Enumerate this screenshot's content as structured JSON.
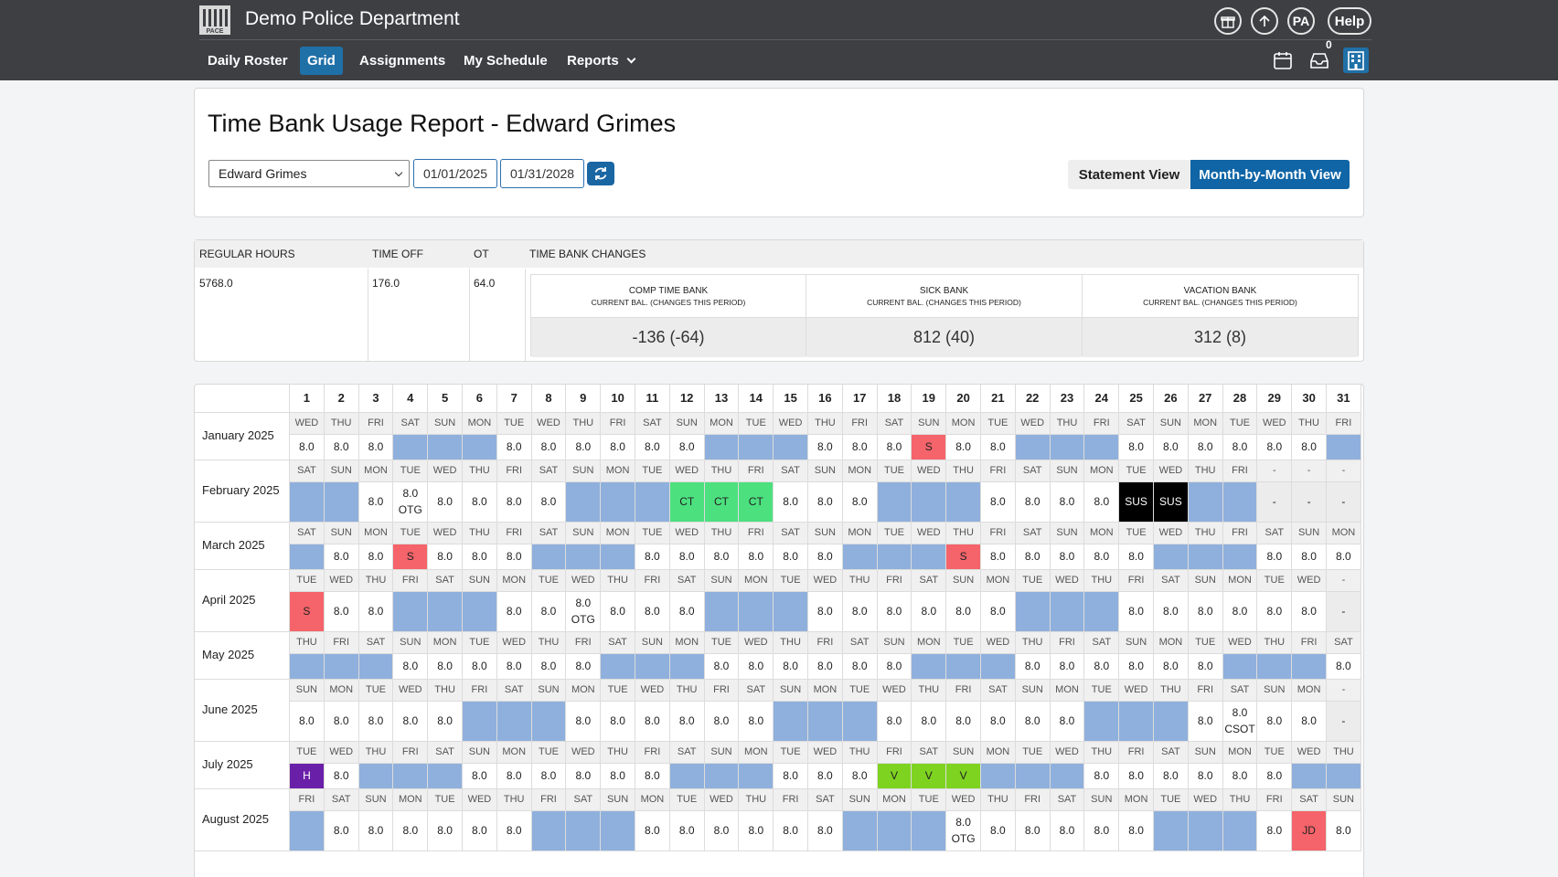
{
  "app": {
    "title": "Demo Police Department",
    "logo_text": "PACE"
  },
  "header_buttons": {
    "gift": "gift-icon",
    "upload": "upload-icon",
    "profile": "PA",
    "help": "Help"
  },
  "nav": [
    {
      "label": "Daily Roster",
      "active": false
    },
    {
      "label": "Grid",
      "active": true
    },
    {
      "label": "Assignments",
      "active": false
    },
    {
      "label": "My Schedule",
      "active": false
    },
    {
      "label": "Reports",
      "active": false,
      "dropdown": true
    }
  ],
  "header_icons": {
    "calendar": "calendar-icon",
    "inbox": "inbox-icon",
    "inbox_count": "0",
    "building": "building-icon"
  },
  "report": {
    "title": "Time Bank Usage Report - Edward Grimes",
    "employee": "Edward Grimes",
    "start_date": "01/01/2025",
    "end_date": "01/31/2028",
    "statement_view": "Statement View",
    "month_view": "Month-by-Month View"
  },
  "summary": {
    "headers": [
      "REGULAR HOURS",
      "TIME OFF",
      "OT",
      "TIME BANK CHANGES"
    ],
    "regular_hours": "5768.0",
    "time_off": "176.0",
    "ot": "64.0",
    "banks": [
      {
        "name": "COMP TIME BANK",
        "sub": "CURRENT BAL. (CHANGES THIS PERIOD)",
        "value": "-136 (-64)"
      },
      {
        "name": "SICK BANK",
        "sub": "CURRENT BAL. (CHANGES THIS PERIOD)",
        "value": "812 (40)"
      },
      {
        "name": "VACATION BANK",
        "sub": "CURRENT BAL. (CHANGES THIS PERIOD)",
        "value": "312 (8)"
      }
    ]
  },
  "colors": {
    "off": "#8fb0dc",
    "sick": "#f4646a",
    "comp": "#4ce07f",
    "vacation": "#7ed321",
    "holiday": "#6a1fa8",
    "suspension": "#000000",
    "blank": "#ececec",
    "accent": "#0f65a6",
    "topbar": "#3d3f43"
  },
  "grid": {
    "days": [
      "1",
      "2",
      "3",
      "4",
      "5",
      "6",
      "7",
      "8",
      "9",
      "10",
      "11",
      "12",
      "13",
      "14",
      "15",
      "16",
      "17",
      "18",
      "19",
      "20",
      "21",
      "22",
      "23",
      "24",
      "25",
      "26",
      "27",
      "28",
      "29",
      "30",
      "31"
    ],
    "months": [
      {
        "label": "January 2025",
        "tall": false,
        "dows": [
          "WED",
          "THU",
          "FRI",
          "SAT",
          "SUN",
          "MON",
          "TUE",
          "WED",
          "THU",
          "FRI",
          "SAT",
          "SUN",
          "MON",
          "TUE",
          "WED",
          "THU",
          "FRI",
          "SAT",
          "SUN",
          "MON",
          "TUE",
          "WED",
          "THU",
          "FRI",
          "SAT",
          "SUN",
          "MON",
          "TUE",
          "WED",
          "THU",
          "FRI"
        ],
        "cells": [
          "8.0",
          "8.0",
          "8.0",
          "off",
          "off",
          "off",
          "8.0",
          "8.0",
          "8.0",
          "8.0",
          "8.0",
          "8.0",
          "off",
          "off",
          "off",
          "8.0",
          "8.0",
          "8.0",
          "S",
          "8.0",
          "8.0",
          "off",
          "off",
          "off",
          "8.0",
          "8.0",
          "8.0",
          "8.0",
          "8.0",
          "8.0",
          "off"
        ]
      },
      {
        "label": "February 2025",
        "tall": true,
        "dows": [
          "SAT",
          "SUN",
          "MON",
          "TUE",
          "WED",
          "THU",
          "FRI",
          "SAT",
          "SUN",
          "MON",
          "TUE",
          "WED",
          "THU",
          "FRI",
          "SAT",
          "SUN",
          "MON",
          "TUE",
          "WED",
          "THU",
          "FRI",
          "SAT",
          "SUN",
          "MON",
          "TUE",
          "WED",
          "THU",
          "FRI",
          "-",
          "-",
          "-"
        ],
        "cells": [
          "off",
          "off",
          "8.0",
          "8.0\nOTG",
          "8.0",
          "8.0",
          "8.0",
          "8.0",
          "off",
          "off",
          "off",
          "CT",
          "CT",
          "CT",
          "8.0",
          "8.0",
          "8.0",
          "off",
          "off",
          "off",
          "8.0",
          "8.0",
          "8.0",
          "8.0",
          "SUS",
          "SUS",
          "off",
          "off",
          "-",
          "-",
          "-"
        ]
      },
      {
        "label": "March 2025",
        "tall": false,
        "dows": [
          "SAT",
          "SUN",
          "MON",
          "TUE",
          "WED",
          "THU",
          "FRI",
          "SAT",
          "SUN",
          "MON",
          "TUE",
          "WED",
          "THU",
          "FRI",
          "SAT",
          "SUN",
          "MON",
          "TUE",
          "WED",
          "THU",
          "FRI",
          "SAT",
          "SUN",
          "MON",
          "TUE",
          "WED",
          "THU",
          "FRI",
          "SAT",
          "SUN",
          "MON"
        ],
        "cells": [
          "off",
          "8.0",
          "8.0",
          "S",
          "8.0",
          "8.0",
          "8.0",
          "off",
          "off",
          "off",
          "8.0",
          "8.0",
          "8.0",
          "8.0",
          "8.0",
          "8.0",
          "off",
          "off",
          "off",
          "S",
          "8.0",
          "8.0",
          "8.0",
          "8.0",
          "8.0",
          "off",
          "off",
          "off",
          "8.0",
          "8.0",
          "8.0"
        ]
      },
      {
        "label": "April 2025",
        "tall": true,
        "dows": [
          "TUE",
          "WED",
          "THU",
          "FRI",
          "SAT",
          "SUN",
          "MON",
          "TUE",
          "WED",
          "THU",
          "FRI",
          "SAT",
          "SUN",
          "MON",
          "TUE",
          "WED",
          "THU",
          "FRI",
          "SAT",
          "SUN",
          "MON",
          "TUE",
          "WED",
          "THU",
          "FRI",
          "SAT",
          "SUN",
          "MON",
          "TUE",
          "WED",
          "-"
        ],
        "cells": [
          "S",
          "8.0",
          "8.0",
          "off",
          "off",
          "off",
          "8.0",
          "8.0",
          "8.0\nOTG",
          "8.0",
          "8.0",
          "8.0",
          "off",
          "off",
          "off",
          "8.0",
          "8.0",
          "8.0",
          "8.0",
          "8.0",
          "8.0",
          "off",
          "off",
          "off",
          "8.0",
          "8.0",
          "8.0",
          "8.0",
          "8.0",
          "8.0",
          "-"
        ]
      },
      {
        "label": "May 2025",
        "tall": false,
        "dows": [
          "THU",
          "FRI",
          "SAT",
          "SUN",
          "MON",
          "TUE",
          "WED",
          "THU",
          "FRI",
          "SAT",
          "SUN",
          "MON",
          "TUE",
          "WED",
          "THU",
          "FRI",
          "SAT",
          "SUN",
          "MON",
          "TUE",
          "WED",
          "THU",
          "FRI",
          "SAT",
          "SUN",
          "MON",
          "TUE",
          "WED",
          "THU",
          "FRI",
          "SAT"
        ],
        "cells": [
          "off",
          "off",
          "off",
          "8.0",
          "8.0",
          "8.0",
          "8.0",
          "8.0",
          "8.0",
          "off",
          "off",
          "off",
          "8.0",
          "8.0",
          "8.0",
          "8.0",
          "8.0",
          "8.0",
          "off",
          "off",
          "off",
          "8.0",
          "8.0",
          "8.0",
          "8.0",
          "8.0",
          "8.0",
          "off",
          "off",
          "off",
          "8.0"
        ]
      },
      {
        "label": "June 2025",
        "tall": true,
        "dows": [
          "SUN",
          "MON",
          "TUE",
          "WED",
          "THU",
          "FRI",
          "SAT",
          "SUN",
          "MON",
          "TUE",
          "WED",
          "THU",
          "FRI",
          "SAT",
          "SUN",
          "MON",
          "TUE",
          "WED",
          "THU",
          "FRI",
          "SAT",
          "SUN",
          "MON",
          "TUE",
          "WED",
          "THU",
          "FRI",
          "SAT",
          "SUN",
          "MON",
          "-"
        ],
        "cells": [
          "8.0",
          "8.0",
          "8.0",
          "8.0",
          "8.0",
          "off",
          "off",
          "off",
          "8.0",
          "8.0",
          "8.0",
          "8.0",
          "8.0",
          "8.0",
          "off",
          "off",
          "off",
          "8.0",
          "8.0",
          "8.0",
          "8.0",
          "8.0",
          "8.0",
          "off",
          "off",
          "off",
          "8.0",
          "8.0\nCSOT",
          "8.0",
          "8.0",
          "-"
        ]
      },
      {
        "label": "July 2025",
        "tall": false,
        "dows": [
          "TUE",
          "WED",
          "THU",
          "FRI",
          "SAT",
          "SUN",
          "MON",
          "TUE",
          "WED",
          "THU",
          "FRI",
          "SAT",
          "SUN",
          "MON",
          "TUE",
          "WED",
          "THU",
          "FRI",
          "SAT",
          "SUN",
          "MON",
          "TUE",
          "WED",
          "THU",
          "FRI",
          "SAT",
          "SUN",
          "MON",
          "TUE",
          "WED",
          "THU"
        ],
        "cells": [
          "H",
          "8.0",
          "off",
          "off",
          "off",
          "8.0",
          "8.0",
          "8.0",
          "8.0",
          "8.0",
          "8.0",
          "off",
          "off",
          "off",
          "8.0",
          "8.0",
          "8.0",
          "V",
          "V",
          "V",
          "off",
          "off",
          "off",
          "8.0",
          "8.0",
          "8.0",
          "8.0",
          "8.0",
          "8.0",
          "off",
          "off"
        ]
      },
      {
        "label": "August 2025",
        "tall": true,
        "dows": [
          "FRI",
          "SAT",
          "SUN",
          "MON",
          "TUE",
          "WED",
          "THU",
          "FRI",
          "SAT",
          "SUN",
          "MON",
          "TUE",
          "WED",
          "THU",
          "FRI",
          "SAT",
          "SUN",
          "MON",
          "TUE",
          "WED",
          "THU",
          "FRI",
          "SAT",
          "SUN",
          "MON",
          "TUE",
          "WED",
          "THU",
          "FRI",
          "SAT",
          "SUN"
        ],
        "cells": [
          "off",
          "8.0",
          "8.0",
          "8.0",
          "8.0",
          "8.0",
          "8.0",
          "off",
          "off",
          "off",
          "8.0",
          "8.0",
          "8.0",
          "8.0",
          "8.0",
          "8.0",
          "off",
          "off",
          "off",
          "8.0\nOTG",
          "8.0",
          "8.0",
          "8.0",
          "8.0",
          "8.0",
          "off",
          "off",
          "off",
          "8.0",
          "JD",
          "8.0"
        ]
      }
    ]
  }
}
